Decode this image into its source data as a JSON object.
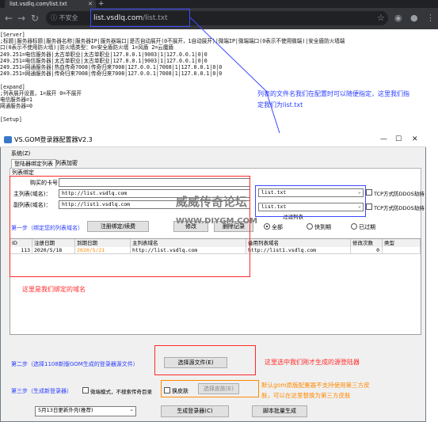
{
  "browser": {
    "tab_title": "list.vsdlq.com/list.txt",
    "insecure_label": "不安全",
    "url_host": "list.vsdlq.com",
    "url_path": "/list.txt"
  },
  "page_text": "[Server]\n;标题|服务器标题|服务器名称|服务器IP|服务器端口|是否自动展开(0不展开，1自动展开)|微端IP|微端端口(0表示不使用微端)|安全盾防火墙端\n口(0表示不使用防火墙)|防火墙类型：0=安全盾防火墙 1=风盾 2=云魔盾\n249.251=电信服务器|太古单职业|太古单职业|127.0.0.1|9003|1|127.0.0.1|0|0\n249.251=电信服务器|太古单职业|太古单职业|127.0.0.1|9003|1|127.0.0.1|0|0\n249.251=网通服务器|热血传奇7008|传奇归来7008|127.0.0.1|7008|1|127.0.0.1|0|0\n249.251=网通服务器|传奇归来7008|传奇归来7008|127.0.0.1|7008|1|127.0.0.1|0|0\n\n[expand]\n;列表展开设置，1=展开 0=不展开\n电信服务器=1\n网通服务器=0\n\n[Setup]",
  "annotations": {
    "top_note_line1": "列表的文件名我们在配置时可以随便指定，这里我们指",
    "top_note_line2": "定我们为list.txt",
    "bound_domain": "这里是我们绑定的域名",
    "select_login": "这里选中我们刚才生成的源登陆器",
    "skin_note_line1": "默认gom原版配置器不支持使用第三方皮",
    "skin_note_line2": "肤，可以在这里替换为第三方皮肤"
  },
  "watermark": {
    "line1": "威威传奇论坛",
    "line2": "WWW.DIYGM.COM"
  },
  "dialog": {
    "title": "VS.GOM登录器配置器V2.3",
    "menu": "系统(Z)",
    "tabs": [
      "登陆器绑定列表",
      "列表加密"
    ],
    "section": "列表绑定",
    "fields": {
      "server_id_label": "购买的卡号：",
      "main_list_label": "主列表(域名)：",
      "main_list_value": "http://list.vsdlq.com",
      "alt_list_label": "副列表(域名)：",
      "alt_list_value": "http://list1.vsdlq.com",
      "main_select": "list.txt",
      "alt_select": "list.txt",
      "tcp_label": "TCP方式防DDOS劫持",
      "filter_label": "过滤列表"
    },
    "step1": "第一步（绑定您的列表域名）",
    "buttons": {
      "register": "注册绑定/续费",
      "modify": "修改",
      "delete": "删除记录",
      "choose_file": "选择源文件(E)",
      "choose_skin": "选择皮肤(E)",
      "generate": "生成登录器(C)",
      "batch": "脚本批量生成"
    },
    "radios": [
      "全部",
      "快到期",
      "已过期"
    ],
    "grid": {
      "headers": [
        "ID",
        "注册日期",
        "到期日期",
        "主列表域名",
        "备用列表域名",
        "修改次数",
        "类型"
      ],
      "row": [
        "113",
        "2020/5/18",
        "2020/5/21",
        "http://list.vsdlq.com",
        "http://list1.vsdlq.com",
        "0",
        ""
      ]
    },
    "step2": "第二步（选择1108新版GOM生成的登录器源文件）",
    "step3": "第三步（生成新登录器）",
    "chk_hide_micro": "微端模式，不搜索传奇目录",
    "chk_skin": "换皮肤",
    "dropdown": "5月13日更新外壳(推荐)"
  }
}
